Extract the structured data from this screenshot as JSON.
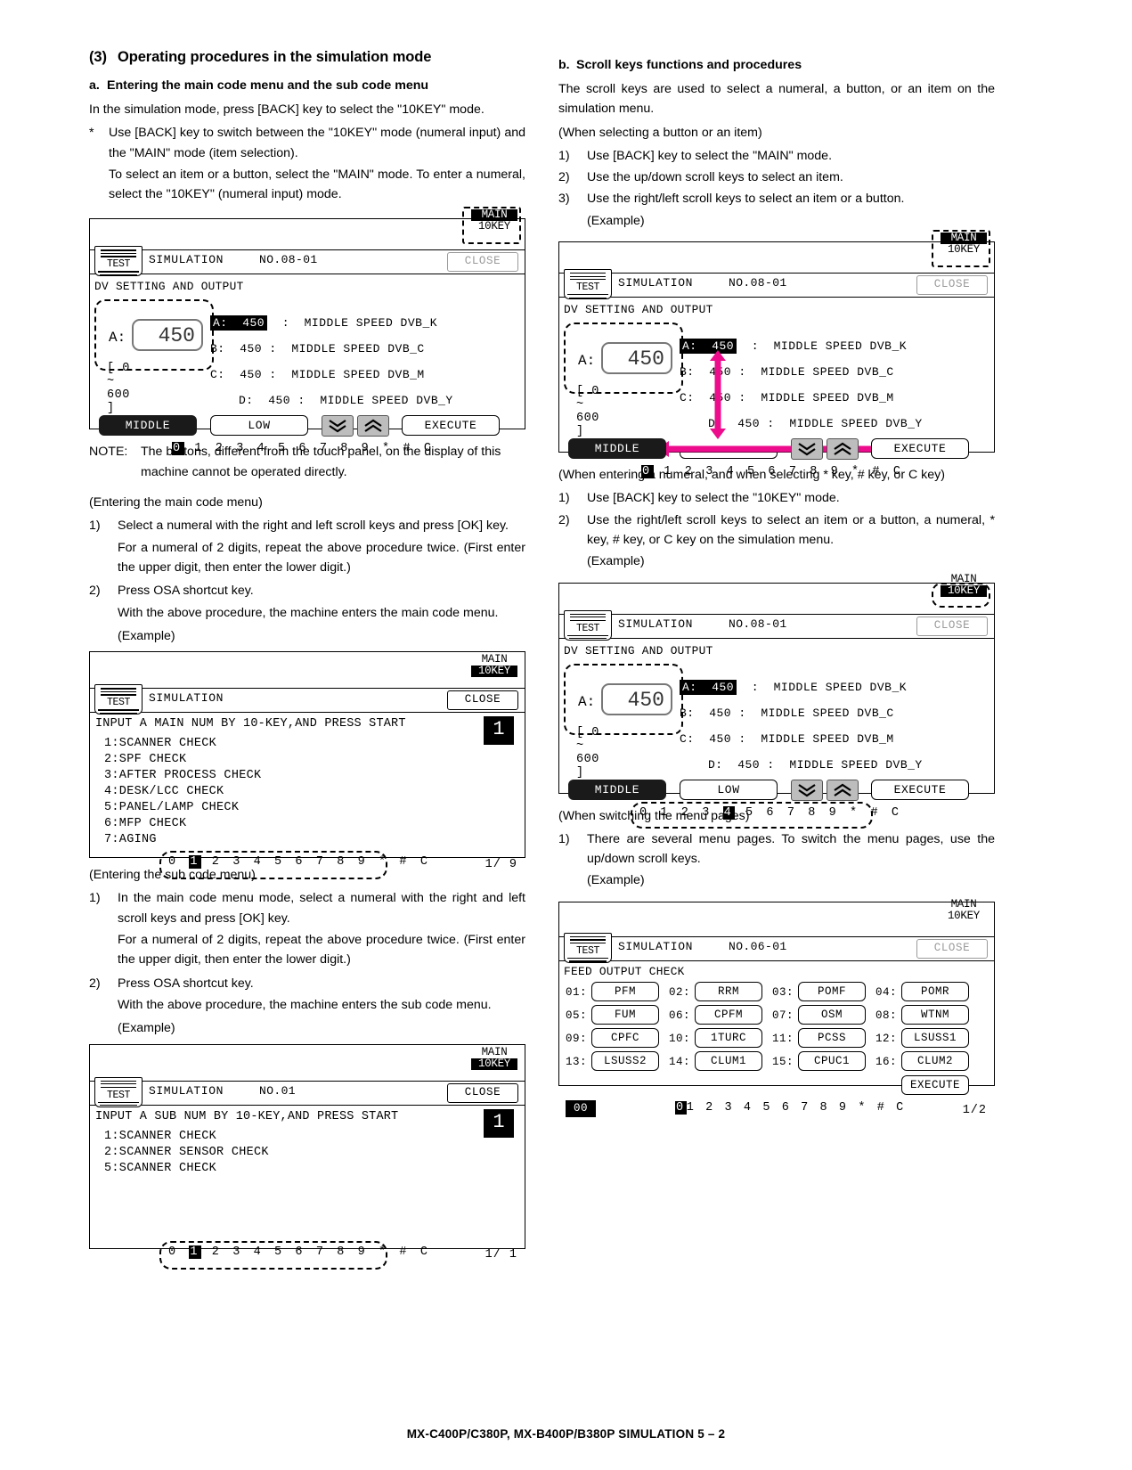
{
  "section": {
    "number": "(3)",
    "title": "Operating procedures in the simulation mode"
  },
  "left": {
    "sub_a": {
      "label": "a.",
      "title": "Entering the main code menu and the sub code menu"
    },
    "p1": "In the simulation mode, press [BACK] key to select the \"10KEY\" mode.",
    "star1_mark": "*",
    "star1": "Use [BACK] key to switch between the \"10KEY\" mode (numeral input) and the \"MAIN\" mode (item selection).",
    "p2": "To select an item or a button, select the \"MAIN\" mode. To enter a numeral, select the \"10KEY\" (numeral input) mode.",
    "note_mark": "NOTE:",
    "note": "The buttons, different from the touch panel, on the display of this machine cannot be operated directly.",
    "entering_main_heading": "(Entering the main code menu)",
    "main_step1_mark": "1)",
    "main_step1": "Select a numeral with the right and left scroll keys and press [OK] key.",
    "main_step1_note": "For a numeral of 2 digits, repeat the above procedure twice. (First enter the upper digit, then enter the lower digit.)",
    "main_step2_mark": "2)",
    "main_step2": "Press OSA shortcut key.",
    "main_step2_note": "With the above procedure, the machine enters the main code menu.",
    "example_label": "(Example)",
    "entering_sub_heading": "(Entering the sub code menu)",
    "sub_step1_mark": "1)",
    "sub_step1": "In the main code menu mode, select a numeral with the right and left scroll keys and press [OK] key.",
    "sub_step1_note": "For a numeral of 2 digits, repeat the above procedure twice. (First enter the upper digit, then enter the lower digit.)",
    "sub_step2_mark": "2)",
    "sub_step2": "Press OSA shortcut key.",
    "sub_step2_note": "With the above procedure, the machine enters the sub code menu.",
    "example_label2": "(Example)"
  },
  "right": {
    "sub_b": {
      "label": "b.",
      "title": "Scroll keys functions and procedures"
    },
    "p1": "The scroll keys are used to select a numeral, a button, or an item on the simulation menu.",
    "p2": "(When selecting a button or an item)",
    "steps": [
      {
        "mark": "1)",
        "text": "Use [BACK] key to select the \"MAIN\" mode."
      },
      {
        "mark": "2)",
        "text": "Use the up/down scroll keys to select an item."
      },
      {
        "mark": "3)",
        "text": "Use the right/left scroll keys to select an item or a button."
      }
    ],
    "example_label": "(Example)",
    "p3": "(When entering a numeral, and when selecting * key, # key, or C key)",
    "steps2": [
      {
        "mark": "1)",
        "text": "Use [BACK] key to select the \"10KEY\" mode."
      },
      {
        "mark": "2)",
        "text": "Use the right/left scroll keys to select an item or a button, a numeral, * key, # key, or C key on the simulation menu."
      }
    ],
    "example_label2": "(Example)",
    "p4": "(When switching the menu pages)",
    "steps3": [
      {
        "mark": "1)",
        "text": "There are several menu pages. To switch the menu pages, use the up/down scroll keys."
      }
    ],
    "example_label3": "(Example)"
  },
  "lcd_common": {
    "test_label": "TEST",
    "simulation_label": "SIMULATION",
    "close_label": "CLOSE",
    "main_label": "MAIN",
    "tenkey_label": "10KEY",
    "keypad": "0 1 2 3 4 5 6 7 8 9 * # C",
    "keypad_keys": [
      "0",
      "1",
      "2",
      "3",
      "4",
      "5",
      "6",
      "7",
      "8",
      "9",
      "*",
      "#",
      "C"
    ]
  },
  "panel_dv1": {
    "sim_no": "NO.08-01",
    "screen_title": "DV SETTING AND OUTPUT",
    "input_label": "A:",
    "input_value": "450",
    "range": "[ 0 ~ 600 ]",
    "rows": [
      {
        "key": "A:",
        "value": "450",
        "sep": ":",
        "desc": "MIDDLE SPEED DVB_K",
        "highlight": true
      },
      {
        "key": "B:",
        "value": "450",
        "sep": ":",
        "desc": "MIDDLE SPEED DVB_C",
        "highlight": false
      },
      {
        "key": "C:",
        "value": "450",
        "sep": ":",
        "desc": "MIDDLE SPEED DVB_M",
        "highlight": false
      },
      {
        "key": "D:",
        "value": "450",
        "sep": ":",
        "desc": "MIDDLE SPEED DVB_Y",
        "highlight": false
      }
    ],
    "btn_middle": "MIDDLE",
    "btn_low": "LOW",
    "btn_execute": "EXECUTE",
    "selected_key": "0",
    "highlight_color": "#000000"
  },
  "panel_dv2": {
    "sim_no": "NO.08-01",
    "screen_title": "DV SETTING AND OUTPUT",
    "input_label": "A:",
    "input_value": "450",
    "range": "[ 0 ~ 600 ]",
    "rows": [
      {
        "key": "A:",
        "value": "450",
        "sep": ":",
        "desc": "MIDDLE SPEED DVB_K",
        "highlight": true
      },
      {
        "key": "B:",
        "value": "450",
        "sep": ":",
        "desc": "MIDDLE SPEED DVB_C",
        "highlight": false
      },
      {
        "key": "C:",
        "value": "450",
        "sep": ":",
        "desc": "MIDDLE SPEED DVB_M",
        "highlight": false
      },
      {
        "key": "D:",
        "value": "450",
        "sep": ":",
        "desc": "MIDDLE SPEED DVB_Y",
        "highlight": false
      }
    ],
    "btn_middle": "MIDDLE",
    "btn_low": "LOW",
    "btn_execute": "EXECUTE",
    "selected_key": "0",
    "arrow_color": "#EC0C8C"
  },
  "panel_dv3": {
    "sim_no": "NO.08-01",
    "screen_title": "DV SETTING AND OUTPUT",
    "input_label": "A:",
    "input_value": "450",
    "range": "[ 0 ~ 600 ]",
    "rows": [
      {
        "key": "A:",
        "value": "450",
        "sep": ":",
        "desc": "MIDDLE SPEED DVB_K",
        "highlight": true
      },
      {
        "key": "B:",
        "value": "450",
        "sep": ":",
        "desc": "MIDDLE SPEED DVB_C",
        "highlight": false
      },
      {
        "key": "C:",
        "value": "450",
        "sep": ":",
        "desc": "MIDDLE SPEED DVB_M",
        "highlight": false
      },
      {
        "key": "D:",
        "value": "450",
        "sep": ":",
        "desc": "MIDDLE SPEED DVB_Y",
        "highlight": false
      }
    ],
    "btn_middle": "MIDDLE",
    "btn_low": "LOW",
    "btn_execute": "EXECUTE",
    "selected_key": "4"
  },
  "panel_main_menu": {
    "message": "INPUT A MAIN NUM BY 10-KEY,AND PRESS START",
    "items": [
      "1:SCANNER CHECK",
      "2:SPF CHECK",
      "3:AFTER PROCESS CHECK",
      "4:DESK/LCC CHECK",
      "5:PANEL/LAMP CHECK",
      "6:MFP CHECK",
      "7:AGING"
    ],
    "big_number": "1",
    "page": "1/ 9",
    "selected_key": "1"
  },
  "panel_sub_menu": {
    "sim_no": "NO.01",
    "message": "INPUT A SUB NUM BY 10-KEY,AND PRESS START",
    "items": [
      "1:SCANNER CHECK",
      "2:SCANNER SENSOR CHECK",
      "5:SCANNER CHECK"
    ],
    "big_number": "1",
    "page": "1/ 1",
    "selected_key": "1"
  },
  "panel_feed": {
    "sim_no": "NO.06-01",
    "screen_title": "FEED OUTPUT CHECK",
    "buttons": [
      {
        "idx": "01:",
        "label": "PFM"
      },
      {
        "idx": "02:",
        "label": "RRM"
      },
      {
        "idx": "03:",
        "label": "POMF"
      },
      {
        "idx": "04:",
        "label": "POMR"
      },
      {
        "idx": "05:",
        "label": "FUM"
      },
      {
        "idx": "06:",
        "label": "CPFM"
      },
      {
        "idx": "07:",
        "label": "OSM"
      },
      {
        "idx": "08:",
        "label": "WTNM"
      },
      {
        "idx": "09:",
        "label": "CPFC"
      },
      {
        "idx": "10:",
        "label": "1TURC"
      },
      {
        "idx": "11:",
        "label": "PCSS"
      },
      {
        "idx": "12:",
        "label": "LSUSS1"
      },
      {
        "idx": "13:",
        "label": "LSUSS2"
      },
      {
        "idx": "14:",
        "label": "CLUM1"
      },
      {
        "idx": "15:",
        "label": "CPUC1"
      },
      {
        "idx": "16:",
        "label": "CLUM2"
      }
    ],
    "btn_execute": "EXECUTE",
    "counter": "00",
    "page": "1/2",
    "selected_key": "0"
  },
  "footer": "MX-C400P/C380P, MX-B400P/B380P  SIMULATION  5 – 2"
}
